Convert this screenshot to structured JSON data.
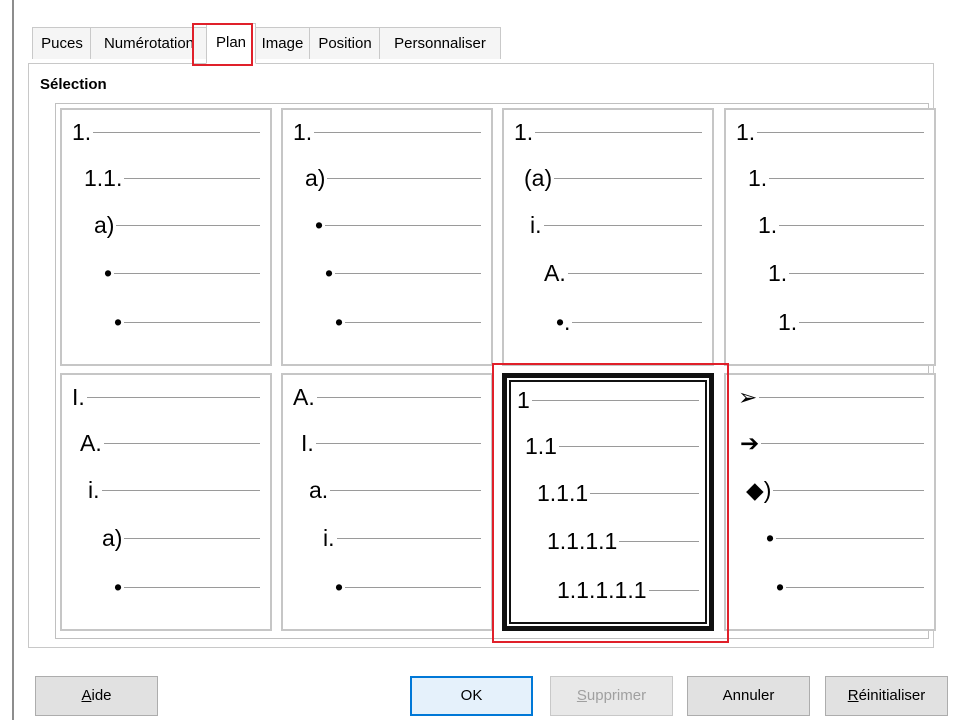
{
  "tabs": [
    "Puces",
    "Numérotation",
    "Plan",
    "Image",
    "Position",
    "Personnaliser"
  ],
  "active_tab": "Plan",
  "section_title": "Sélection",
  "cells": [
    {
      "name": "outline-1",
      "items": [
        "1.",
        "1.1.",
        "a)",
        "•",
        "•"
      ]
    },
    {
      "name": "outline-2",
      "items": [
        "1.",
        "a)",
        "•",
        "•",
        "•"
      ]
    },
    {
      "name": "outline-3",
      "items": [
        "1.",
        "(a)",
        "i.",
        "A.",
        "•."
      ]
    },
    {
      "name": "outline-4",
      "items": [
        "1.",
        "1.",
        "1.",
        "1.",
        "1."
      ]
    },
    {
      "name": "outline-5",
      "items": [
        "I.",
        "A.",
        "i.",
        "a)",
        "•"
      ]
    },
    {
      "name": "outline-6",
      "items": [
        "A.",
        "I.",
        "a.",
        "i.",
        "•"
      ]
    },
    {
      "name": "outline-7",
      "items": [
        "1",
        "1.1",
        "1.1.1",
        "1.1.1.1",
        "1.1.1.1.1"
      ]
    },
    {
      "name": "outline-8",
      "items": [
        "➢",
        "➔",
        "◆)",
        "•",
        "•"
      ]
    }
  ],
  "selected_cell": "outline-7",
  "buttons": {
    "help": {
      "first": "A",
      "rest": "ide"
    },
    "ok": "OK",
    "delete": {
      "first": "S",
      "rest": "upprimer"
    },
    "cancel": "Annuler",
    "reset": {
      "first": "R",
      "rest": "éinitialiser"
    }
  }
}
